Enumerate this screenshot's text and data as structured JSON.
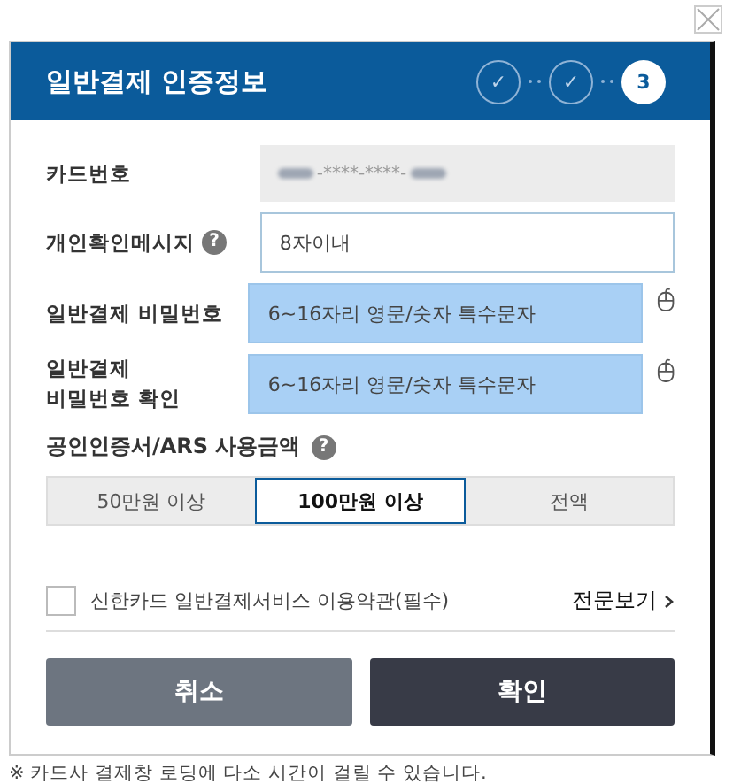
{
  "dialog": {
    "title": "일반결제 인증정보",
    "steps": [
      {
        "label": "✓",
        "done": true
      },
      {
        "label": "✓",
        "done": true
      },
      {
        "label": "3",
        "done": false
      }
    ]
  },
  "fields": [
    {
      "kind": "masked",
      "label": "카드번호",
      "value": "-****-****-"
    },
    {
      "kind": "text",
      "label": "개인확인메시지",
      "help": "?",
      "placeholder": "8자이내"
    },
    {
      "kind": "password",
      "label": "일반결제 비밀번호",
      "placeholder": "6~16자리 영문/숫자 특수문자"
    },
    {
      "kind": "password",
      "label": "일반결제\n비밀번호 확인",
      "placeholder": "6~16자리 영문/숫자 특수문자"
    }
  ],
  "amount": {
    "label": "공인인증서/ARS 사용금액",
    "help": "?",
    "options": [
      {
        "label": "50만원 이상",
        "selected": false
      },
      {
        "label": "100만원 이상",
        "selected": true
      },
      {
        "label": "전액",
        "selected": false
      }
    ]
  },
  "agreement": {
    "label": "신한카드 일반결제서비스 이용약관(필수)",
    "checked": false,
    "link": "전문보기"
  },
  "buttons": [
    {
      "kind": "cancel",
      "label": "취소"
    },
    {
      "kind": "confirm",
      "label": "확인"
    }
  ],
  "notice": "※ 카드사 결제창 로딩에 다소 시간이 걸릴 수 있습니다."
}
